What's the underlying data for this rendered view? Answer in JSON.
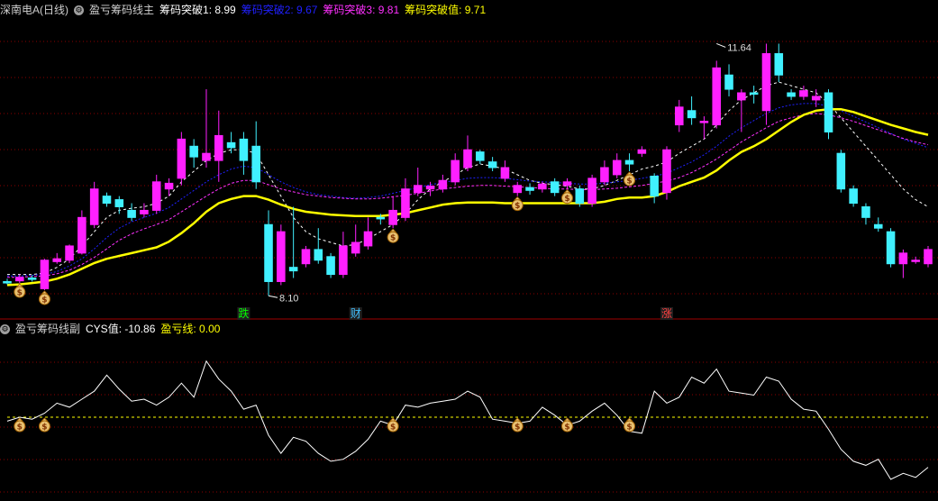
{
  "header_main": {
    "stock": "深南电A(日线)",
    "indicator": "盈亏筹码线主",
    "items": [
      {
        "label": "筹码突破1: 8.99",
        "color": "#ffffff"
      },
      {
        "label": "筹码突破2: 9.67",
        "color": "#0000ff"
      },
      {
        "label": "筹码突破3: 9.81",
        "color": "#ff00ff"
      },
      {
        "label": "筹码突破值: 9.71",
        "color": "#ffff00"
      }
    ]
  },
  "header_sub": {
    "indicator": "盈亏筹码线副",
    "items": [
      {
        "label": "CYS值: -10.86",
        "color": "#ffffff"
      },
      {
        "label": "盈亏线: 0.00",
        "color": "#ffff00"
      }
    ]
  },
  "colors": {
    "up": "#ff20ff",
    "down": "#40f0ff",
    "grid": "#8b0000",
    "line_white": "#ffffff",
    "line_blue": "#2020ff",
    "line_magenta": "#ff30ff",
    "line_yellow": "#ffff00"
  },
  "chart_data": [
    {
      "type": "candlestick",
      "title": "盈亏筹码线主",
      "ylim": [
        7.8,
        12.0
      ],
      "annotations": {
        "high": {
          "label": "11.64",
          "index": 57
        },
        "low": {
          "label": "8.10",
          "index": 21
        }
      },
      "markers": [
        {
          "index": 19,
          "label": "跌",
          "color": "#00ff00"
        },
        {
          "index": 28,
          "label": "财",
          "color": "#40c0ff"
        },
        {
          "index": 53,
          "label": "涨",
          "color": "#ff4040"
        }
      ],
      "money_icons": [
        1,
        3,
        31,
        41,
        45,
        50
      ],
      "candles": [
        [
          8.3,
          8.28,
          8.26,
          8.34
        ],
        [
          8.31,
          8.36,
          8.28,
          8.4
        ],
        [
          8.35,
          8.33,
          8.3,
          8.39
        ],
        [
          8.2,
          8.6,
          8.18,
          8.62
        ],
        [
          8.58,
          8.62,
          8.55,
          8.7
        ],
        [
          8.6,
          8.8,
          8.56,
          8.82
        ],
        [
          8.7,
          9.2,
          8.68,
          9.3
        ],
        [
          9.1,
          9.6,
          9.05,
          9.7
        ],
        [
          9.5,
          9.4,
          9.35,
          9.55
        ],
        [
          9.45,
          9.35,
          9.25,
          9.5
        ],
        [
          9.3,
          9.2,
          9.15,
          9.4
        ],
        [
          9.25,
          9.3,
          9.2,
          9.4
        ],
        [
          9.3,
          9.7,
          9.25,
          9.8
        ],
        [
          9.6,
          9.68,
          9.5,
          9.75
        ],
        [
          9.75,
          10.3,
          9.65,
          10.4
        ],
        [
          10.2,
          10.05,
          9.9,
          10.3
        ],
        [
          10.0,
          10.1,
          9.9,
          11.0
        ],
        [
          10.0,
          10.35,
          9.7,
          10.7
        ],
        [
          10.25,
          10.18,
          10.1,
          10.4
        ],
        [
          10.3,
          10.0,
          9.8,
          10.4
        ],
        [
          10.2,
          9.7,
          9.6,
          10.55
        ],
        [
          9.1,
          8.3,
          8.1,
          9.3
        ],
        [
          8.3,
          9.0,
          8.25,
          9.1
        ],
        [
          8.5,
          8.45,
          8.35,
          9.35
        ],
        [
          8.55,
          8.75,
          8.5,
          8.8
        ],
        [
          8.75,
          8.6,
          8.55,
          9.05
        ],
        [
          8.65,
          8.4,
          8.35,
          8.7
        ],
        [
          8.4,
          8.8,
          8.35,
          9.0
        ],
        [
          8.7,
          8.85,
          8.65,
          9.1
        ],
        [
          8.8,
          9.0,
          8.75,
          9.2
        ],
        [
          9.2,
          9.18,
          9.1,
          9.25
        ],
        [
          9.1,
          9.3,
          9.05,
          9.5
        ],
        [
          9.2,
          9.6,
          9.15,
          9.75
        ],
        [
          9.55,
          9.65,
          9.5,
          9.9
        ],
        [
          9.6,
          9.64,
          9.5,
          9.7
        ],
        [
          9.6,
          9.72,
          9.55,
          9.8
        ],
        [
          9.7,
          10.0,
          9.65,
          10.1
        ],
        [
          9.9,
          10.15,
          9.85,
          10.35
        ],
        [
          10.12,
          10.0,
          9.95,
          10.15
        ],
        [
          9.98,
          9.9,
          9.85,
          10.05
        ],
        [
          9.75,
          9.9,
          9.7,
          10.0
        ],
        [
          9.55,
          9.65,
          9.5,
          9.7
        ],
        [
          9.62,
          9.58,
          9.52,
          9.68
        ],
        [
          9.6,
          9.67,
          9.55,
          9.7
        ],
        [
          9.7,
          9.55,
          9.5,
          9.75
        ],
        [
          9.65,
          9.7,
          9.6,
          9.75
        ],
        [
          9.6,
          9.4,
          9.35,
          9.65
        ],
        [
          9.4,
          9.75,
          9.35,
          9.8
        ],
        [
          9.7,
          9.9,
          9.65,
          10.0
        ],
        [
          9.8,
          10.0,
          9.75,
          10.1
        ],
        [
          10.0,
          9.95,
          9.85,
          10.1
        ],
        [
          10.1,
          10.15,
          10.05,
          10.2
        ],
        [
          9.78,
          9.5,
          9.4,
          9.82
        ],
        [
          9.55,
          10.15,
          9.45,
          10.2
        ],
        [
          10.5,
          10.75,
          10.4,
          10.85
        ],
        [
          10.7,
          10.6,
          10.5,
          10.9
        ],
        [
          10.55,
          10.55,
          10.3,
          10.62
        ],
        [
          10.5,
          11.3,
          10.45,
          11.4
        ],
        [
          11.2,
          11.0,
          10.9,
          11.35
        ],
        [
          10.85,
          10.95,
          10.4,
          11.0
        ],
        [
          10.95,
          10.93,
          10.8,
          11.05
        ],
        [
          10.7,
          11.5,
          10.5,
          11.64
        ],
        [
          11.5,
          11.2,
          11.1,
          11.64
        ],
        [
          10.95,
          10.9,
          10.85,
          11.0
        ],
        [
          10.9,
          10.98,
          10.85,
          11.05
        ],
        [
          10.85,
          10.9,
          10.75,
          11.0
        ],
        [
          10.95,
          10.4,
          10.3,
          11.0
        ],
        [
          10.1,
          9.6,
          9.55,
          10.15
        ],
        [
          9.6,
          9.4,
          9.35,
          9.65
        ],
        [
          9.35,
          9.2,
          9.1,
          9.4
        ],
        [
          9.1,
          9.05,
          9.0,
          9.2
        ],
        [
          9.0,
          8.55,
          8.5,
          9.05
        ],
        [
          8.55,
          8.7,
          8.35,
          8.75
        ],
        [
          8.6,
          8.6,
          8.55,
          8.65
        ],
        [
          8.55,
          8.75,
          8.5,
          8.8
        ]
      ],
      "series": [
        {
          "name": "筹码突破1",
          "style": "dashed",
          "values": [
            8.4,
            8.4,
            8.4,
            8.42,
            8.5,
            8.62,
            8.8,
            9.0,
            9.2,
            9.3,
            9.33,
            9.35,
            9.4,
            9.5,
            9.7,
            9.85,
            10.0,
            10.1,
            10.15,
            10.15,
            10.1,
            9.8,
            9.5,
            9.2,
            9.0,
            8.9,
            8.85,
            8.8,
            8.82,
            8.9,
            9.0,
            9.1,
            9.25,
            9.45,
            9.6,
            9.7,
            9.8,
            9.9,
            9.95,
            9.92,
            9.88,
            9.8,
            9.72,
            9.68,
            9.66,
            9.64,
            9.6,
            9.6,
            9.65,
            9.72,
            9.8,
            9.88,
            9.92,
            9.98,
            10.1,
            10.2,
            10.3,
            10.5,
            10.7,
            10.85,
            10.95,
            11.05,
            11.1,
            11.05,
            11.0,
            10.95,
            10.8,
            10.6,
            10.4,
            10.2,
            10.0,
            9.8,
            9.6,
            9.45,
            9.35
          ]
        },
        {
          "name": "筹码突破2",
          "style": "dotted",
          "values": [
            8.38,
            8.38,
            8.39,
            8.4,
            8.44,
            8.52,
            8.62,
            8.76,
            8.92,
            9.05,
            9.14,
            9.2,
            9.26,
            9.34,
            9.46,
            9.58,
            9.7,
            9.8,
            9.88,
            9.92,
            9.9,
            9.8,
            9.7,
            9.62,
            9.56,
            9.52,
            9.5,
            9.48,
            9.47,
            9.48,
            9.5,
            9.54,
            9.58,
            9.62,
            9.66,
            9.69,
            9.72,
            9.75,
            9.76,
            9.76,
            9.75,
            9.73,
            9.71,
            9.7,
            9.69,
            9.68,
            9.67,
            9.67,
            9.68,
            9.7,
            9.72,
            9.75,
            9.78,
            9.82,
            9.9,
            9.98,
            10.08,
            10.2,
            10.34,
            10.46,
            10.56,
            10.66,
            10.74,
            10.78,
            10.8,
            10.8,
            10.76,
            10.7,
            10.62,
            10.54,
            10.46,
            10.38,
            10.3,
            10.24,
            10.18
          ]
        },
        {
          "name": "筹码突破3",
          "style": "dashed",
          "values": [
            8.36,
            8.36,
            8.37,
            8.38,
            8.41,
            8.46,
            8.54,
            8.64,
            8.76,
            8.88,
            8.97,
            9.04,
            9.1,
            9.17,
            9.28,
            9.39,
            9.5,
            9.6,
            9.68,
            9.72,
            9.72,
            9.66,
            9.6,
            9.56,
            9.52,
            9.5,
            9.48,
            9.47,
            9.46,
            9.46,
            9.47,
            9.49,
            9.51,
            9.54,
            9.57,
            9.6,
            9.62,
            9.64,
            9.65,
            9.65,
            9.64,
            9.63,
            9.62,
            9.61,
            9.6,
            9.6,
            9.59,
            9.59,
            9.6,
            9.61,
            9.63,
            9.65,
            9.68,
            9.71,
            9.76,
            9.83,
            9.92,
            10.02,
            10.14,
            10.26,
            10.36,
            10.46,
            10.55,
            10.6,
            10.64,
            10.66,
            10.64,
            10.6,
            10.55,
            10.49,
            10.43,
            10.37,
            10.31,
            10.26,
            10.22
          ]
        },
        {
          "name": "筹码突破值",
          "style": "solid",
          "values": [
            8.25,
            8.26,
            8.28,
            8.3,
            8.34,
            8.4,
            8.48,
            8.56,
            8.62,
            8.66,
            8.7,
            8.74,
            8.78,
            8.86,
            8.98,
            9.12,
            9.28,
            9.4,
            9.46,
            9.5,
            9.5,
            9.45,
            9.38,
            9.32,
            9.28,
            9.26,
            9.24,
            9.23,
            9.22,
            9.22,
            9.22,
            9.24,
            9.26,
            9.3,
            9.34,
            9.38,
            9.4,
            9.41,
            9.41,
            9.41,
            9.4,
            9.4,
            9.4,
            9.4,
            9.4,
            9.4,
            9.4,
            9.4,
            9.42,
            9.46,
            9.48,
            9.48,
            9.5,
            9.56,
            9.64,
            9.7,
            9.76,
            9.86,
            10.0,
            10.12,
            10.2,
            10.3,
            10.42,
            10.54,
            10.64,
            10.7,
            10.72,
            10.72,
            10.68,
            10.62,
            10.56,
            10.5,
            10.45,
            10.4,
            10.36
          ]
        }
      ]
    },
    {
      "type": "line",
      "title": "盈亏筹码线副",
      "ylim": [
        -20,
        20
      ],
      "series": [
        {
          "name": "CYS值",
          "style": "solid",
          "values": [
            -1.0,
            0.0,
            -0.5,
            1.0,
            3.5,
            2.5,
            4.5,
            6.5,
            10.5,
            7.0,
            4.0,
            4.5,
            3.0,
            5.0,
            8.5,
            5.0,
            14.0,
            9.5,
            6.5,
            2.0,
            3.0,
            -4.5,
            -9.0,
            -5.0,
            -6.0,
            -9.0,
            -11.0,
            -10.5,
            -8.5,
            -5.5,
            -1.0,
            -2.0,
            3.0,
            2.5,
            3.5,
            4.0,
            4.5,
            6.5,
            5.0,
            -0.5,
            -1.0,
            -1.5,
            -1.0,
            2.5,
            0.5,
            -2.0,
            -1.0,
            1.5,
            3.5,
            0.5,
            -3.5,
            -4.0,
            6.5,
            3.5,
            5.0,
            10.0,
            8.5,
            12.0,
            6.5,
            6.0,
            5.5,
            10.0,
            9.0,
            4.5,
            2.0,
            1.5,
            -3.0,
            -8.0,
            -11.0,
            -12.0,
            -10.5,
            -15.5,
            -14.0,
            -15.0,
            -12.5
          ]
        },
        {
          "name": "盈亏线",
          "style": "dashed",
          "values": [
            0,
            0,
            0,
            0,
            0,
            0,
            0,
            0,
            0,
            0,
            0,
            0,
            0,
            0,
            0,
            0,
            0,
            0,
            0,
            0,
            0,
            0,
            0,
            0,
            0,
            0,
            0,
            0,
            0,
            0,
            0,
            0,
            0,
            0,
            0,
            0,
            0,
            0,
            0,
            0,
            0,
            0,
            0,
            0,
            0,
            0,
            0,
            0,
            0,
            0,
            0,
            0,
            0,
            0,
            0,
            0,
            0,
            0,
            0,
            0,
            0,
            0,
            0,
            0,
            0,
            0,
            0,
            0,
            0,
            0,
            0,
            0,
            0,
            0,
            0
          ]
        }
      ],
      "money_icons": [
        1,
        3,
        31,
        41,
        45,
        50
      ]
    }
  ]
}
